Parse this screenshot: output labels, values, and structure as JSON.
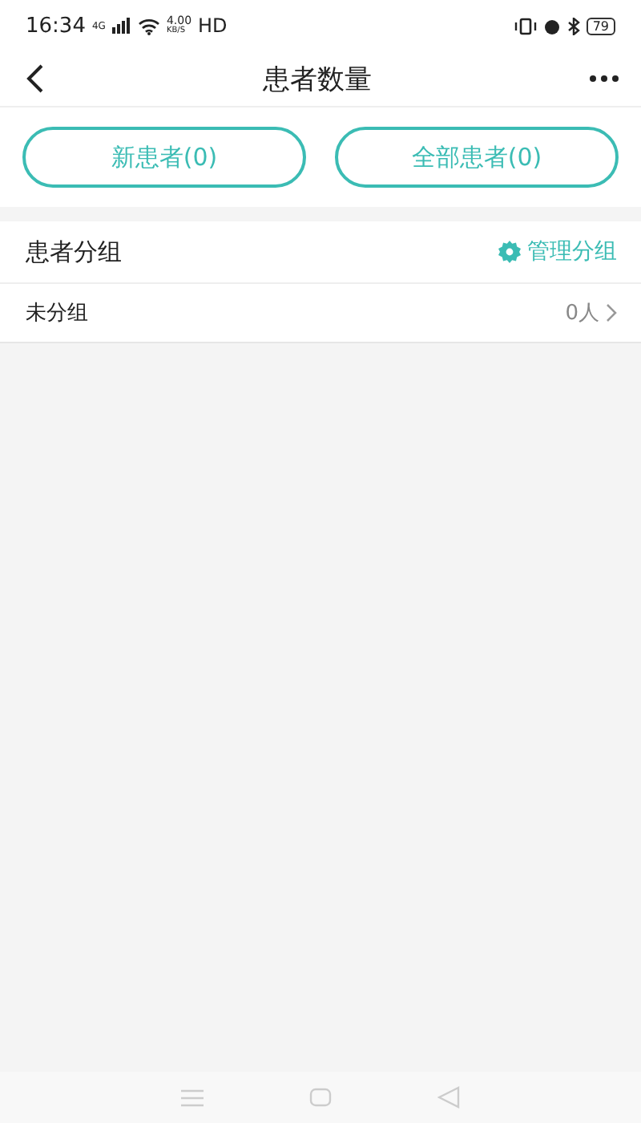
{
  "status_bar": {
    "time": "16:34",
    "network": "4G",
    "speed": "4.00",
    "speed_unit": "KB/S",
    "hd": "HD",
    "battery": "79"
  },
  "nav": {
    "title": "患者数量"
  },
  "filters": [
    {
      "label": "新患者(0)"
    },
    {
      "label": "全部患者(0)"
    }
  ],
  "group_section": {
    "title": "患者分组",
    "manage": "管理分组"
  },
  "groups": [
    {
      "name": "未分组",
      "count": "0人"
    }
  ]
}
